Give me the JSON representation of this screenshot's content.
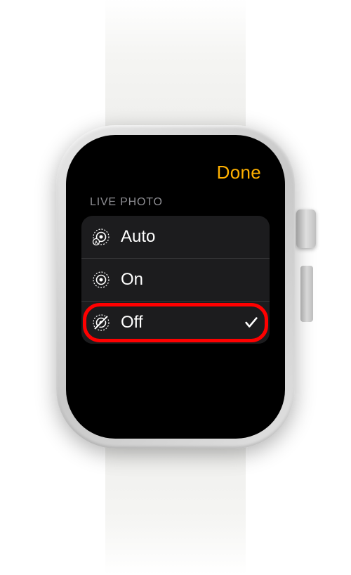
{
  "header": {
    "done_label": "Done"
  },
  "section": {
    "title": "LIVE PHOTO"
  },
  "options": [
    {
      "key": "auto",
      "label": "Auto",
      "icon": "live-photo-auto-icon",
      "selected": false,
      "highlighted": false
    },
    {
      "key": "on",
      "label": "On",
      "icon": "live-photo-on-icon",
      "selected": false,
      "highlighted": false
    },
    {
      "key": "off",
      "label": "Off",
      "icon": "live-photo-off-icon",
      "selected": true,
      "highlighted": true
    }
  ],
  "colors": {
    "accent": "#ffb000",
    "highlight": "#ff0000",
    "background": "#000000",
    "row_background": "#1c1c1e"
  }
}
